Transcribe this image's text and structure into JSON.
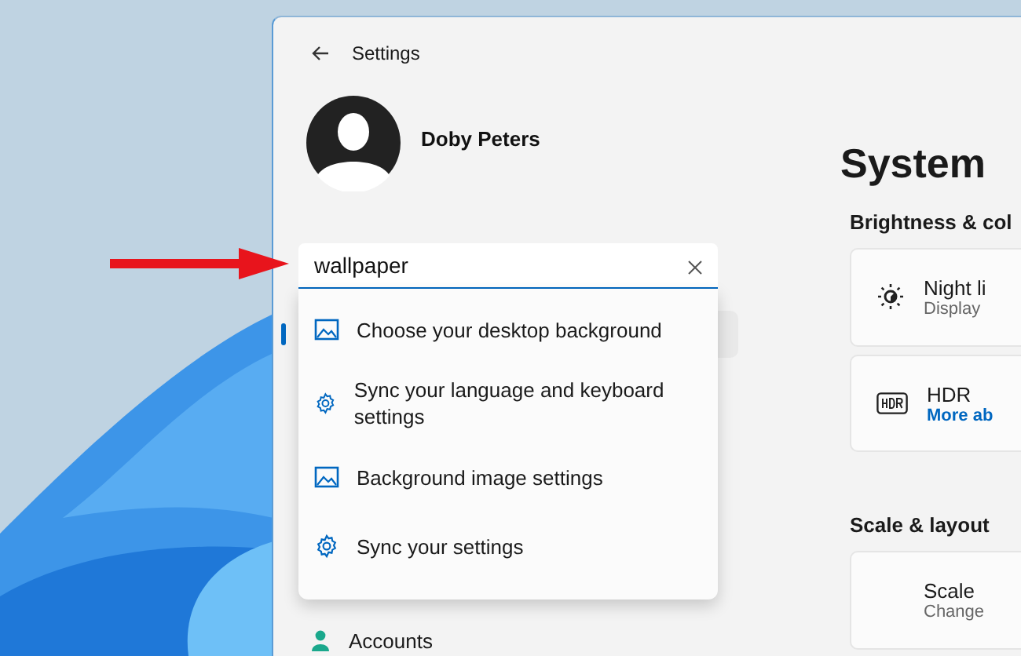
{
  "window": {
    "title": "Settings"
  },
  "user": {
    "name": "Doby Peters"
  },
  "search": {
    "value": "wallpaper"
  },
  "suggestions": [
    {
      "kind": "image",
      "label": "Choose your desktop background"
    },
    {
      "kind": "gear",
      "label": "Sync your language and keyboard settings"
    },
    {
      "kind": "image",
      "label": "Background image settings"
    },
    {
      "kind": "gear",
      "label": "Sync your settings"
    }
  ],
  "nav": {
    "items": [
      {
        "label": "Accounts"
      }
    ]
  },
  "content": {
    "title": "System",
    "sections": [
      {
        "heading": "Brightness & col",
        "cards": [
          {
            "kind": "sun",
            "title": "Night li",
            "subtitle": "Display",
            "link": false
          },
          {
            "kind": "hdr",
            "title": "HDR",
            "subtitle": "More ab",
            "link": true
          }
        ]
      },
      {
        "heading": "Scale & layout",
        "cards": [
          {
            "kind": "blank",
            "title": "Scale",
            "subtitle": "Change",
            "link": false
          }
        ]
      }
    ]
  }
}
